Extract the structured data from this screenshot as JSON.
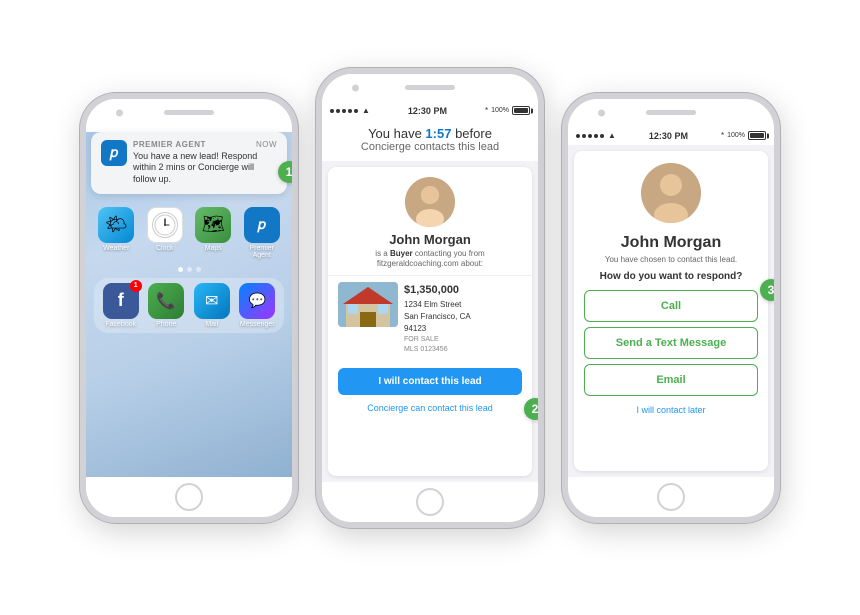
{
  "phone1": {
    "notification": {
      "app_name": "PREMIER AGENT",
      "time": "now",
      "message": "You have a new lead! Respond within 2 mins or Concierge will follow up."
    },
    "icons_row1": [
      {
        "label": "Weather",
        "type": "weather"
      },
      {
        "label": "Clock",
        "type": "clock"
      },
      {
        "label": "Maps",
        "type": "maps"
      },
      {
        "label": "Premier Agent",
        "type": "pa"
      }
    ],
    "icons_row2": [
      {
        "label": "Facebook",
        "type": "fb",
        "badge": "1"
      },
      {
        "label": "Phone",
        "type": "phone"
      },
      {
        "label": "Mail",
        "type": "mail"
      },
      {
        "label": "Messenger",
        "type": "messenger"
      }
    ],
    "step_badge": "1"
  },
  "phone2": {
    "status": {
      "time": "12:30 PM",
      "battery": "100%"
    },
    "header": "You have ",
    "timer": "1:57",
    "header2": " before",
    "subheader": "Concierge contacts this lead",
    "lead": {
      "name": "John Morgan",
      "desc_prefix": "is a ",
      "buyer_text": "Buyer",
      "desc_suffix": " contacting you from fitzgeraldcoaching.com about:"
    },
    "property": {
      "price": "$1,350,000",
      "address1": "1234 Elm Street",
      "address2": "San Francisco, CA",
      "zip": "94123",
      "status": "FOR SALE",
      "mls": "MLS 0123456"
    },
    "contact_btn": "I will contact this lead",
    "concierge_link": "Concierge can contact this lead",
    "step_badge": "2"
  },
  "phone3": {
    "status": {
      "time": "12:30 PM",
      "battery": "100%"
    },
    "lead_name": "John Morgan",
    "desc": "You have chosen to contact this lead.",
    "question": "How do you want to respond?",
    "buttons": [
      {
        "label": "Call"
      },
      {
        "label": "Send a Text Message"
      },
      {
        "label": "Email"
      }
    ],
    "later_link": "I will contact later",
    "step_badge": "3"
  }
}
